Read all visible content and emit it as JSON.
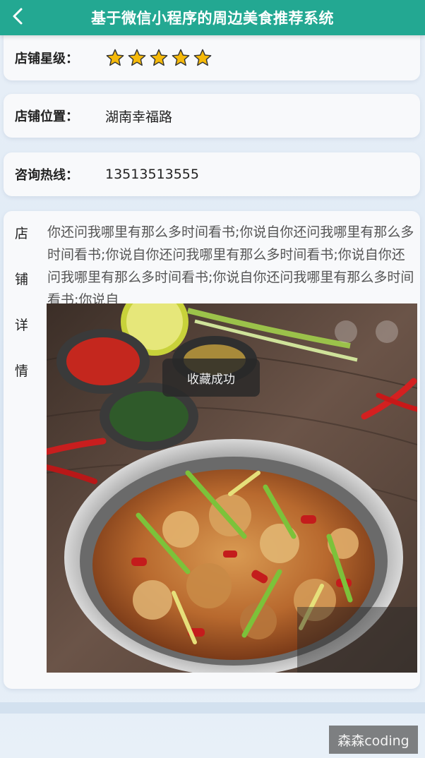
{
  "header": {
    "title": "基于微信小程序的周边美食推荐系统",
    "background_color": "#23a892",
    "back_icon": "chevron-left-icon"
  },
  "shop": {
    "rating_label": "店铺星级：",
    "rating_stars": 5,
    "star_color": "#f5b90a",
    "location_label": "店铺位置：",
    "location_value": "湖南幸福路",
    "hotline_label": "咨询热线：",
    "hotline_value": "13513513555"
  },
  "details": {
    "label_chars": [
      "店",
      "铺",
      "详",
      "情"
    ],
    "text": "你还问我哪里有那么多时间看书;你说自你还问我哪里有那么多时间看书;你说自你还问我哪里有那么多时间看书;你说自你还问我哪里有那么多时间看书;你说自你还问我哪里有那么多时间看书;你说自",
    "image_subject": "spicy-chicken-dish-photo"
  },
  "toast": {
    "text": "收藏成功"
  },
  "watermark": {
    "text": "森森coding"
  }
}
